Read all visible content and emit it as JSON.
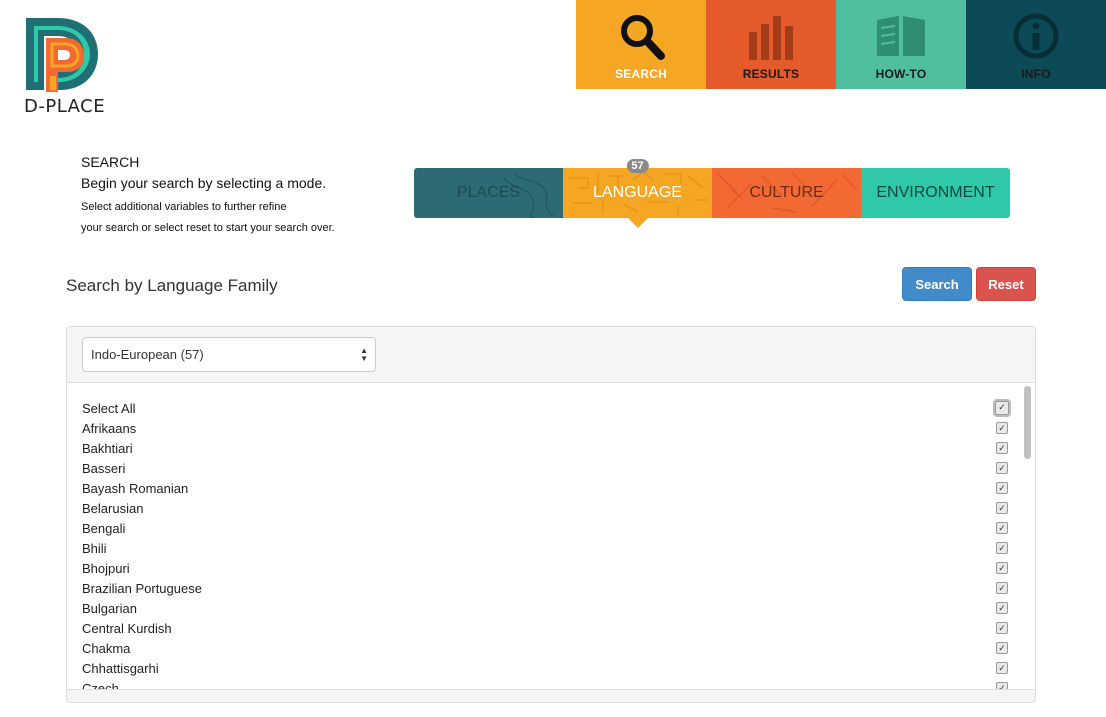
{
  "brand": {
    "name": "D-PLACE"
  },
  "nav": [
    {
      "label": "SEARCH",
      "color": "#f5a623",
      "text_color": "#ffffff",
      "icon": "magnifier-icon"
    },
    {
      "label": "RESULTS",
      "color": "#e55a2b",
      "text_color": "#1b1b1b",
      "icon": "bar-chart-icon"
    },
    {
      "label": "HOW-TO",
      "color": "#4fbf9f",
      "text_color": "#1b1b1b",
      "icon": "book-icon"
    },
    {
      "label": "INFO",
      "color": "#0d4a57",
      "text_color": "#1b1b1b",
      "icon": "info-icon"
    }
  ],
  "search_intro": {
    "title": "SEARCH",
    "lead": "Begin your search by selecting a mode.",
    "line1": "Select additional variables to further refine",
    "line2": "your search or select reset to start your search over."
  },
  "modes": {
    "places": "PLACES",
    "language": "LANGUAGE",
    "culture": "CULTURE",
    "environment": "ENVIRONMENT",
    "active": "language",
    "language_count": "57"
  },
  "section": {
    "heading": "Search by Language Family",
    "search_button": "Search",
    "reset_button": "Reset"
  },
  "family_select": {
    "value": "Indo-European (57)"
  },
  "languages": [
    {
      "name": "Select All",
      "checked": true,
      "select_all": true
    },
    {
      "name": "Afrikaans",
      "checked": true
    },
    {
      "name": "Bakhtiari",
      "checked": true
    },
    {
      "name": "Basseri",
      "checked": true
    },
    {
      "name": "Bayash Romanian",
      "checked": true
    },
    {
      "name": "Belarusian",
      "checked": true
    },
    {
      "name": "Bengali",
      "checked": true
    },
    {
      "name": "Bhili",
      "checked": true
    },
    {
      "name": "Bhojpuri",
      "checked": true
    },
    {
      "name": "Brazilian Portuguese",
      "checked": true
    },
    {
      "name": "Bulgarian",
      "checked": true
    },
    {
      "name": "Central Kurdish",
      "checked": true
    },
    {
      "name": "Chakma",
      "checked": true
    },
    {
      "name": "Chhattisgarhi",
      "checked": true
    },
    {
      "name": "Czech",
      "checked": true
    }
  ]
}
